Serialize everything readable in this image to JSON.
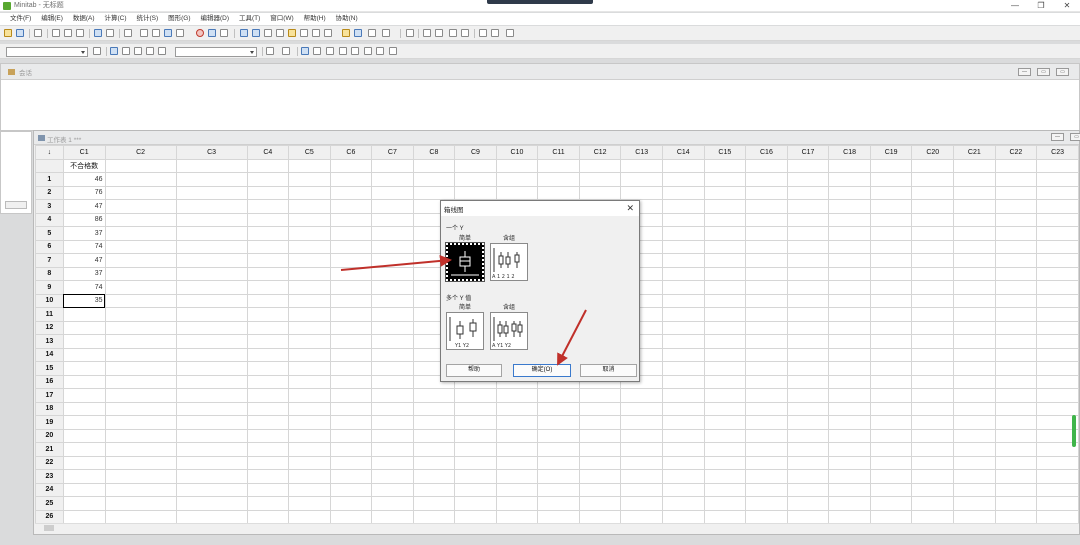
{
  "app": {
    "title": "Minitab - 无标题",
    "controls": [
      "—",
      "❐",
      "✕"
    ]
  },
  "menu": [
    "文件(F)",
    "编辑(E)",
    "数据(A)",
    "计算(C)",
    "统计(S)",
    "图形(G)",
    "编辑器(D)",
    "工具(T)",
    "窗口(W)",
    "帮助(H)",
    "协助(N)"
  ],
  "session": {
    "title": "会话"
  },
  "worksheet": {
    "title": "工作表 1 ***",
    "columns": [
      "C1",
      "C2",
      "C3",
      "C4",
      "C5",
      "C6",
      "C7",
      "C8",
      "C9",
      "C10",
      "C11",
      "C12",
      "C13",
      "C14",
      "C15",
      "C16",
      "C17",
      "C18",
      "C19",
      "C20",
      "C21",
      "C22",
      "C23"
    ],
    "corner": "↓",
    "column_names": [
      "不合格数"
    ],
    "c1_values": [
      "46",
      "76",
      "47",
      "86",
      "37",
      "74",
      "47",
      "37",
      "74",
      "35"
    ],
    "row_count": 26,
    "selected_row": 10
  },
  "dialog": {
    "title": "箱线图",
    "group_one": "一个 Y",
    "group_many": "多个 Y 值",
    "simple": "简单",
    "with_groups": "含组",
    "selected_option": "one-y-simple",
    "help_button": "帮助",
    "ok_button": "确定(O)",
    "cancel_button": "取消",
    "close_glyph": "✕"
  },
  "annotations": {
    "arrow_color": "#c0302a"
  }
}
